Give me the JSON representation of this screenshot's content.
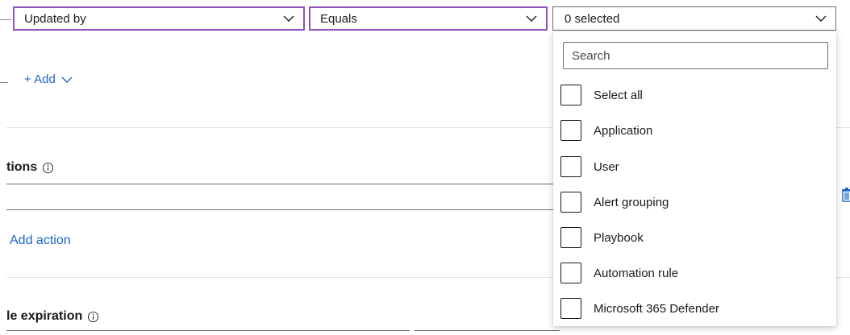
{
  "filter": {
    "field": "Updated by",
    "operator": "Equals",
    "value_summary": "0 selected"
  },
  "add_link": "+ Add",
  "sections": {
    "actions_title": "tions",
    "add_action": "Add action",
    "expiration_title": "le expiration"
  },
  "dropdown": {
    "search_placeholder": "Search",
    "options": [
      {
        "label": "Select all",
        "checked": false
      },
      {
        "label": "Application",
        "checked": false
      },
      {
        "label": "User",
        "checked": false
      },
      {
        "label": "Alert grouping",
        "checked": false
      },
      {
        "label": "Playbook",
        "checked": false
      },
      {
        "label": "Automation rule",
        "checked": false
      },
      {
        "label": "Microsoft 365 Defender",
        "checked": false
      }
    ]
  },
  "icons": {
    "chevron": "chevron-down-icon",
    "info": "info-icon",
    "delete": "trash-icon"
  },
  "colors": {
    "accent_link": "#1b66c9",
    "focus_border": "#8f52b8",
    "border": "#6b6b6b",
    "divider": "#e1e1e1"
  }
}
